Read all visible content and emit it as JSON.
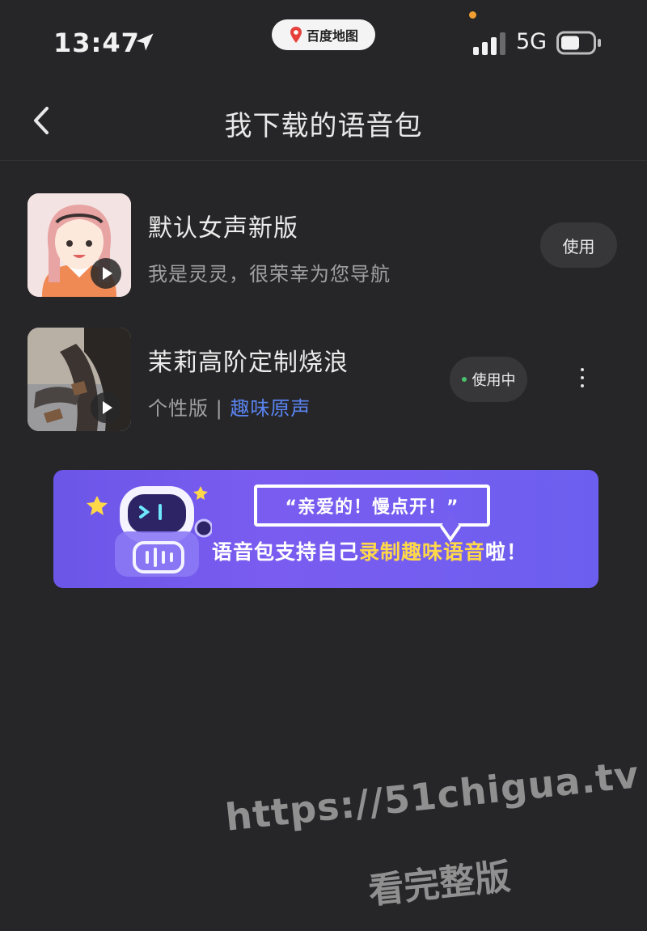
{
  "status_bar": {
    "time": "13:47",
    "app_name": "百度地图",
    "network": "5G",
    "location_icon": "location-arrow-icon",
    "signal_icon": "cellular-signal-icon",
    "battery_icon": "battery-icon"
  },
  "nav": {
    "title": "我下载的语音包",
    "back_icon": "chevron-left-icon"
  },
  "voice_packs": [
    {
      "title": "默认女声新版",
      "subtitle": "我是灵灵，很荣幸为您导航",
      "button_label": "使用",
      "play_icon": "play-icon"
    },
    {
      "title": "茉莉高阶定制烧浪",
      "subtitle_prefix": "个性版 | ",
      "subtitle_tag": "趣味原声",
      "button_label": "使用中",
      "status_dot_color": "#49c26c",
      "play_icon": "play-icon",
      "more_icon": "more-vertical-icon"
    }
  ],
  "banner": {
    "quote": "“亲爱的！慢点开！”",
    "text_prefix": "语音包支持自己",
    "text_highlight": "录制趣味语音",
    "text_suffix": "啦！",
    "background_color": "#6b56e8",
    "highlight_color": "#ffd84a"
  },
  "watermark": {
    "line1": "https://51chigua.tv",
    "line2": "看完整版"
  },
  "colors": {
    "background": "#262628",
    "button_bg": "#37373a",
    "tag_blue": "#5a84f0"
  }
}
